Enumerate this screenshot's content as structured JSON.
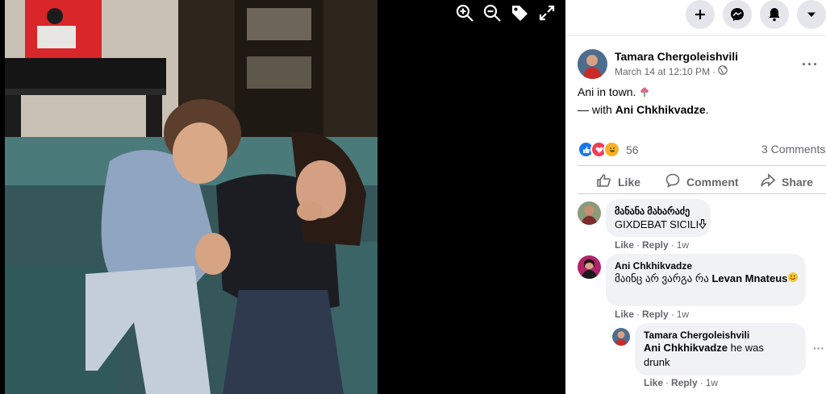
{
  "viewer": {
    "tools": [
      {
        "name": "zoom-in-icon"
      },
      {
        "name": "zoom-out-icon"
      },
      {
        "name": "tag-icon"
      },
      {
        "name": "fullscreen-icon"
      }
    ]
  },
  "topbar": {
    "buttons": [
      "plus-icon",
      "messenger-icon",
      "notifications-icon",
      "account-dropdown-icon"
    ]
  },
  "post": {
    "author": "Tamara Chergoleishvili",
    "date": "March 14 at 12:10 PM",
    "date_separator": "·",
    "privacy_icon": "public-globe-icon",
    "text_line1": "Ani in town.",
    "with_prefix": "— with",
    "with_name": "Ani Chkhikvadze",
    "with_suffix": ".",
    "reactions": {
      "icons": [
        "like",
        "love",
        "haha"
      ],
      "count": "56"
    },
    "comments_count": "3 Comments",
    "actions": {
      "like": "Like",
      "comment": "Comment",
      "share": "Share"
    }
  },
  "comments": [
    {
      "author": "მანანა მახარაძე",
      "text": "GIXDEBAT SICILI",
      "like": "Like",
      "reply": "Reply",
      "time": "1w"
    },
    {
      "author": "Ani Chkhikvadze",
      "text_part1": "მაინც არ ვარგა რა",
      "text_mention": "Levan Mnateus",
      "like": "Like",
      "reply": "Reply",
      "time": "1w"
    },
    {
      "author": "Tamara Chergoleishvili",
      "mention": "Ani Chkhikvadze",
      "text": "he was drunk",
      "like": "Like",
      "reply": "Reply",
      "time": "1w"
    }
  ],
  "colors": {
    "accent": "#1877f2",
    "like": "#1877f2",
    "love": "#f33e58",
    "haha": "#f7b125",
    "muted": "#65676b"
  }
}
